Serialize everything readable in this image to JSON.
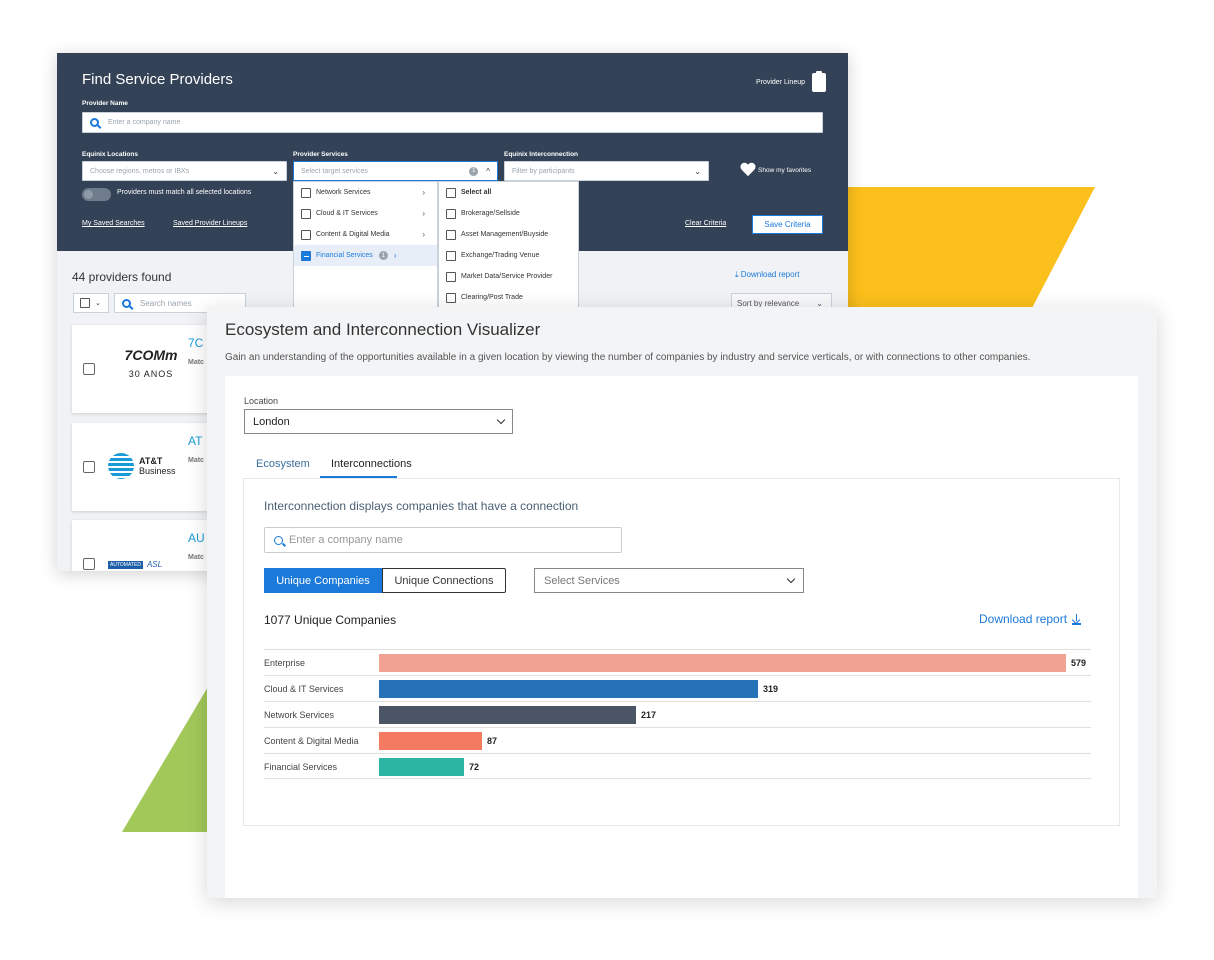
{
  "finder": {
    "title": "Find Service Providers",
    "provider_lineup": "Provider Lineup",
    "provider_name_label": "Provider Name",
    "company_placeholder": "Enter a company name",
    "locations_label": "Equinix Locations",
    "locations_placeholder": "Choose regions, metros or IBXs",
    "services_label": "Provider Services",
    "services_placeholder": "Select target services",
    "services_count": "1",
    "interconnection_label": "Equinix Interconnection",
    "participants_placeholder": "Filter by participants",
    "favorites": "Show my favorites",
    "match_all": "Providers must match all selected locations",
    "saved_searches": "My Saved Searches",
    "saved_lineups": "Saved Provider Lineups",
    "clear_criteria": "Clear Criteria",
    "save_criteria": "Save Criteria",
    "menu_categories": [
      {
        "label": "Network Services",
        "selected": false
      },
      {
        "label": "Cloud & IT Services",
        "selected": false
      },
      {
        "label": "Content & Digital Media",
        "selected": false
      },
      {
        "label": "Financial Services",
        "selected": true,
        "count": "1"
      }
    ],
    "menu_sub": [
      "Select all",
      "Brokerage/Sellside",
      "Asset Management/Buyside",
      "Exchange/Trading Venue",
      "Market Data/Service Provider",
      "Clearing/Post Trade"
    ],
    "providers_found": "44 providers found",
    "download_report": "Download report",
    "search_names": "Search names",
    "sort": "Sort by relevance",
    "cards": [
      {
        "name": "7C",
        "match": "Matc",
        "logo": "7COMm",
        "logo_sub": "30 ANOS"
      },
      {
        "name": "AT",
        "match": "Matc",
        "logo": "AT&T",
        "logo_sub": "Business"
      },
      {
        "name": "AU",
        "match": "Matc",
        "logo": "AUTOMATED",
        "logo_sub": "ASL"
      }
    ]
  },
  "visualizer": {
    "title": "Ecosystem and Interconnection Visualizer",
    "subtitle": "Gain an understanding of the opportunities available in a given location by viewing the number of companies by industry and service verticals, or with connections to other companies.",
    "location_label": "Location",
    "location_value": "London",
    "tabs": [
      "Ecosystem",
      "Interconnections"
    ],
    "active_tab": "Interconnections",
    "description": "Interconnection displays companies that have a connection",
    "company_placeholder": "Enter a company name",
    "toggle_unique_companies": "Unique Companies",
    "toggle_unique_connections": "Unique Connections",
    "services_placeholder": "Select Services",
    "count_label": "1077 Unique Companies",
    "download_report": "Download report"
  },
  "colors": {
    "header": "#334256",
    "accent": "#1b79d9",
    "yellow": "#fcc01c",
    "green": "#a2c85a"
  },
  "chart_data": {
    "type": "bar",
    "orientation": "horizontal",
    "categories": [
      "Enterprise",
      "Cloud & IT Services",
      "Network Services",
      "Content & Digital Media",
      "Financial Services"
    ],
    "values": [
      579,
      319,
      217,
      87,
      72
    ],
    "colors": [
      "#f2a293",
      "#2672b8",
      "#4b5566",
      "#f57a62",
      "#2db5a3"
    ],
    "xlim": [
      0,
      579
    ]
  }
}
